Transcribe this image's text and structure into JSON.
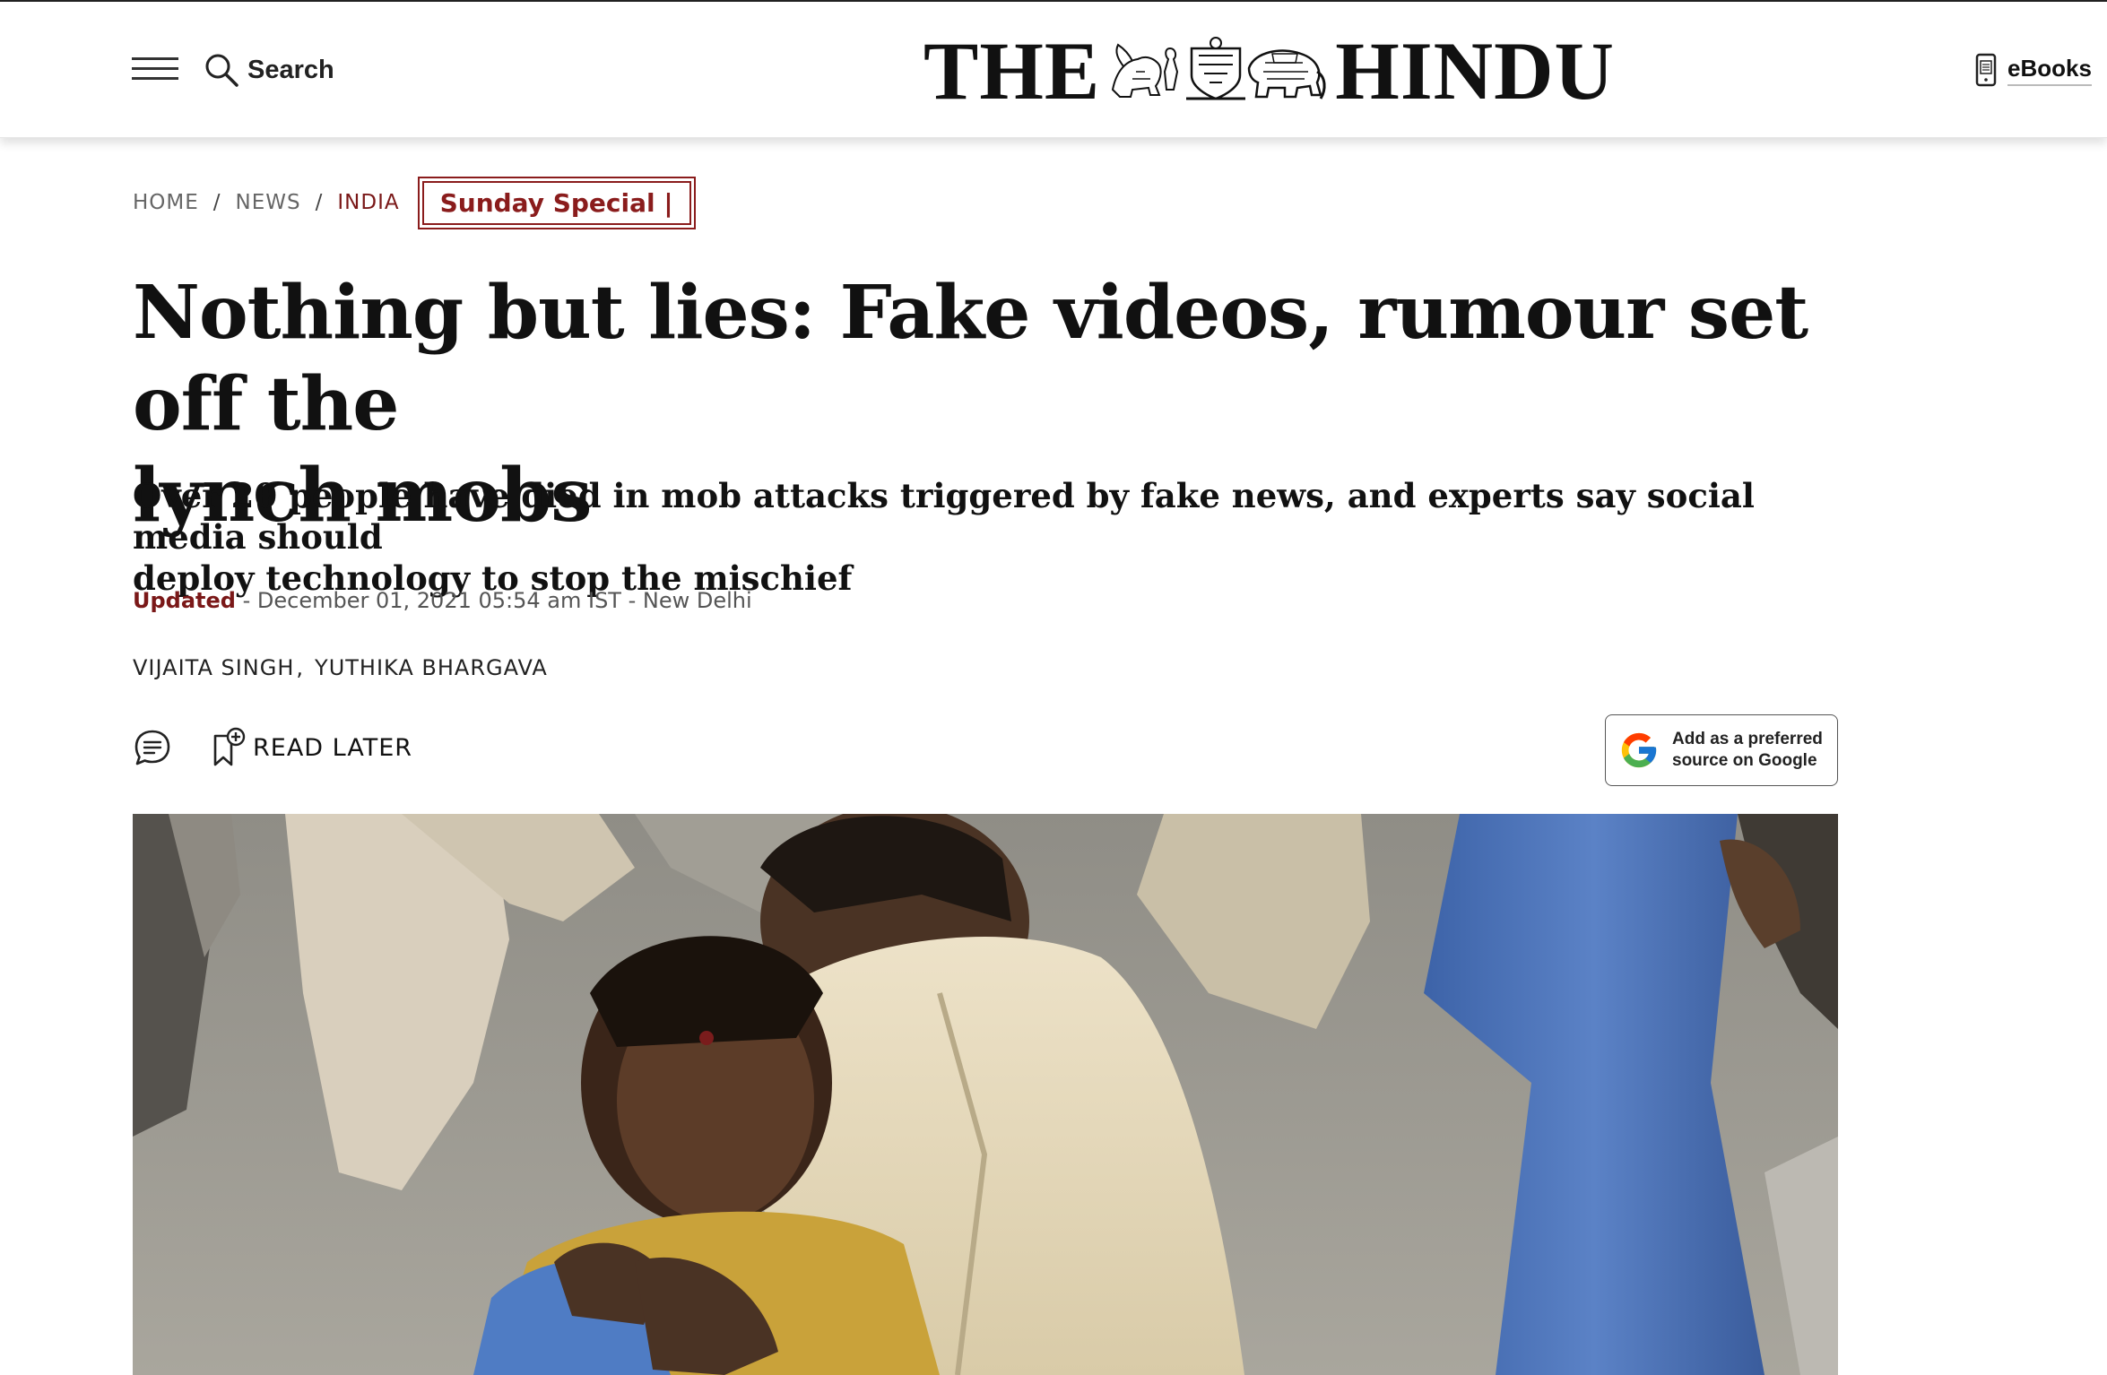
{
  "header": {
    "search_label": "Search",
    "logo_left": "THE",
    "logo_right": "HINDU",
    "ebooks_label": "eBooks"
  },
  "breadcrumb": {
    "items": [
      "HOME",
      "NEWS",
      "INDIA"
    ],
    "separator": "/",
    "badge": "Sunday Special |"
  },
  "article": {
    "headline_line1": "Nothing but lies: Fake videos, rumour set off the",
    "headline_line2": "lynch mobs",
    "subhead_line1": "Over 20 people have died in mob attacks triggered by fake news, and experts say social media should",
    "subhead_line2": "deploy technology to stop the mischief",
    "updated_label": "Updated",
    "dateline": " - December 01, 2021 05:54 am IST - New Delhi",
    "authors": [
      "VIJAITA SINGH",
      "YUTHIKA BHARGAVA"
    ],
    "author_separator": ","
  },
  "actions": {
    "read_later_label": "READ LATER",
    "google_source_line1": "Add as a preferred",
    "google_source_line2": "source on Google"
  },
  "icons": {
    "menu": "hamburger-icon",
    "search": "search-icon",
    "ebook": "ebook-icon",
    "comment": "comment-icon",
    "bookmark": "bookmark-add-icon",
    "google": "google-g-icon"
  },
  "colors": {
    "accent": "#7a1818",
    "badge_border": "#8a1c1c",
    "text": "#111111",
    "muted": "#666666"
  }
}
